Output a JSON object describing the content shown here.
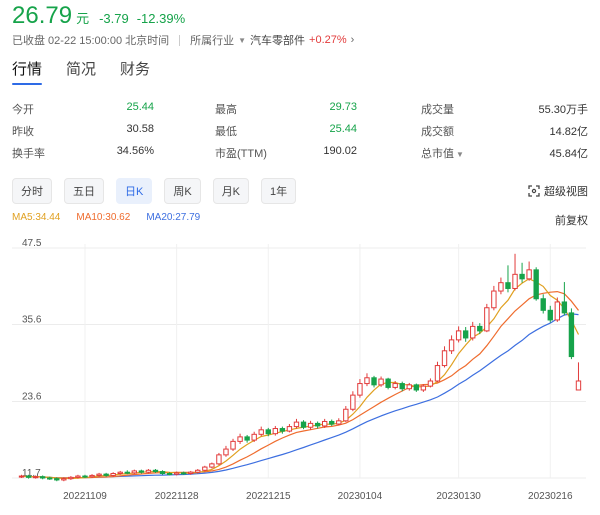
{
  "quote": {
    "price": "26.79",
    "unit": "元",
    "change": "-3.79",
    "change_pct": "-12.39%",
    "status": "已收盘 02-22 15:00:00 北京时间",
    "industry_label": "所属行业",
    "industry_name": "汽车零部件",
    "industry_change": "+0.27%"
  },
  "main_tabs": [
    {
      "label": "行情",
      "active": true
    },
    {
      "label": "简况",
      "active": false
    },
    {
      "label": "财务",
      "active": false
    }
  ],
  "stats": [
    [
      {
        "label": "今开",
        "value": "25.44",
        "tone": "down"
      },
      {
        "label": "最高",
        "value": "29.73",
        "tone": "down"
      },
      {
        "label": "成交量",
        "value": "55.30万手",
        "tone": ""
      }
    ],
    [
      {
        "label": "昨收",
        "value": "30.58",
        "tone": ""
      },
      {
        "label": "最低",
        "value": "25.44",
        "tone": "down"
      },
      {
        "label": "成交额",
        "value": "14.82亿",
        "tone": ""
      }
    ],
    [
      {
        "label": "换手率",
        "value": "34.56%",
        "tone": ""
      },
      {
        "label": "市盈(TTM)",
        "value": "190.02",
        "tone": ""
      },
      {
        "label": "总市值",
        "value": "45.84亿",
        "tone": "",
        "caret": true
      }
    ]
  ],
  "periods": [
    {
      "label": "分时",
      "active": false
    },
    {
      "label": "五日",
      "active": false
    },
    {
      "label": "日K",
      "active": true
    },
    {
      "label": "周K",
      "active": false
    },
    {
      "label": "月K",
      "active": false
    },
    {
      "label": "1年",
      "active": false
    }
  ],
  "super_view_label": "超级视图",
  "ma": {
    "ma5": "MA5:34.44",
    "ma10": "MA10:30.62",
    "ma20": "MA20:27.79"
  },
  "adjust_label": "前复权",
  "chart_data": {
    "type": "candlestick",
    "y_ticks": [
      "47.5",
      "35.6",
      "23.6",
      "11.7"
    ],
    "ylim": [
      11.7,
      47.5
    ],
    "x_ticks": [
      "20221109",
      "20221128",
      "20221215",
      "20230104",
      "20230130",
      "20230216"
    ],
    "x_tick_index": [
      9,
      22,
      35,
      48,
      62,
      75
    ],
    "colors": {
      "up": "#e23b3b",
      "down": "#16a34a",
      "ma5": "#e0a020",
      "ma10": "#ef6c2e",
      "ma20": "#3d6fe0"
    },
    "candles": [
      [
        11.9,
        12.0,
        12.2,
        11.7
      ],
      [
        12.0,
        11.8,
        12.2,
        11.6
      ],
      [
        11.8,
        11.9,
        12.1,
        11.6
      ],
      [
        11.9,
        11.7,
        12.1,
        11.5
      ],
      [
        11.7,
        11.6,
        11.9,
        11.4
      ],
      [
        11.6,
        11.4,
        11.8,
        11.2
      ],
      [
        11.4,
        11.6,
        11.8,
        11.2
      ],
      [
        11.6,
        11.8,
        12.0,
        11.4
      ],
      [
        11.8,
        12.0,
        12.2,
        11.6
      ],
      [
        12.0,
        11.9,
        12.2,
        11.7
      ],
      [
        11.9,
        12.1,
        12.3,
        11.7
      ],
      [
        12.1,
        12.3,
        12.5,
        11.9
      ],
      [
        12.3,
        12.1,
        12.5,
        11.9
      ],
      [
        12.1,
        12.4,
        12.6,
        11.9
      ],
      [
        12.4,
        12.6,
        12.8,
        12.2
      ],
      [
        12.6,
        12.5,
        12.9,
        12.3
      ],
      [
        12.5,
        12.8,
        13.0,
        12.3
      ],
      [
        12.8,
        12.6,
        13.0,
        12.4
      ],
      [
        12.6,
        12.9,
        13.1,
        12.4
      ],
      [
        12.9,
        12.7,
        13.1,
        12.5
      ],
      [
        12.7,
        12.4,
        12.9,
        12.2
      ],
      [
        12.4,
        12.3,
        12.6,
        12.1
      ],
      [
        12.3,
        12.5,
        12.7,
        12.1
      ],
      [
        12.5,
        12.4,
        12.7,
        12.2
      ],
      [
        12.4,
        12.6,
        12.8,
        12.2
      ],
      [
        12.6,
        12.9,
        13.1,
        12.4
      ],
      [
        12.9,
        13.4,
        13.6,
        12.7
      ],
      [
        13.4,
        13.9,
        14.1,
        13.2
      ],
      [
        13.9,
        15.3,
        15.6,
        13.7
      ],
      [
        15.3,
        16.2,
        16.7,
        15.0
      ],
      [
        16.2,
        17.4,
        17.8,
        15.9
      ],
      [
        17.4,
        18.1,
        18.6,
        17.0
      ],
      [
        18.1,
        17.6,
        18.4,
        17.2
      ],
      [
        17.6,
        18.5,
        18.9,
        17.3
      ],
      [
        18.5,
        19.2,
        19.7,
        18.2
      ],
      [
        19.2,
        18.6,
        19.5,
        18.2
      ],
      [
        18.6,
        19.4,
        19.8,
        18.3
      ],
      [
        19.4,
        19.0,
        19.7,
        18.6
      ],
      [
        19.0,
        19.7,
        20.1,
        18.8
      ],
      [
        19.7,
        20.4,
        20.9,
        19.4
      ],
      [
        20.4,
        19.6,
        20.7,
        19.3
      ],
      [
        19.6,
        20.2,
        20.6,
        19.2
      ],
      [
        20.2,
        19.8,
        20.5,
        19.4
      ],
      [
        19.8,
        20.5,
        20.9,
        19.5
      ],
      [
        20.5,
        20.1,
        20.8,
        19.8
      ],
      [
        20.1,
        20.6,
        21.0,
        19.9
      ],
      [
        20.6,
        22.4,
        22.9,
        20.4
      ],
      [
        22.4,
        24.6,
        25.2,
        22.1
      ],
      [
        24.6,
        26.4,
        27.1,
        24.2
      ],
      [
        26.4,
        27.3,
        28.0,
        26.0
      ],
      [
        27.3,
        26.2,
        27.6,
        25.8
      ],
      [
        26.2,
        27.1,
        27.5,
        25.9
      ],
      [
        27.1,
        25.8,
        27.3,
        25.5
      ],
      [
        25.8,
        26.4,
        26.8,
        25.5
      ],
      [
        26.4,
        25.6,
        26.7,
        25.2
      ],
      [
        25.6,
        26.2,
        26.5,
        25.3
      ],
      [
        26.2,
        25.4,
        26.4,
        25.1
      ],
      [
        25.4,
        26.0,
        26.3,
        25.1
      ],
      [
        26.0,
        26.8,
        27.2,
        25.8
      ],
      [
        26.8,
        29.2,
        29.8,
        26.6
      ],
      [
        29.2,
        31.5,
        32.2,
        28.9
      ],
      [
        31.5,
        33.2,
        33.9,
        31.0
      ],
      [
        33.2,
        34.6,
        35.3,
        32.8
      ],
      [
        34.6,
        33.5,
        35.2,
        32.9
      ],
      [
        33.5,
        35.3,
        36.0,
        33.1
      ],
      [
        35.3,
        34.6,
        35.8,
        34.1
      ],
      [
        34.6,
        38.2,
        38.8,
        34.4
      ],
      [
        38.2,
        40.8,
        41.6,
        37.8
      ],
      [
        40.8,
        42.1,
        42.9,
        40.3
      ],
      [
        42.1,
        41.2,
        44.8,
        40.6
      ],
      [
        41.2,
        43.4,
        46.6,
        40.9
      ],
      [
        43.4,
        42.7,
        45.2,
        42.1
      ],
      [
        42.7,
        44.1,
        45.4,
        42.4
      ],
      [
        44.1,
        39.6,
        44.5,
        39.3
      ],
      [
        39.6,
        37.8,
        40.3,
        37.3
      ],
      [
        37.8,
        36.3,
        38.5,
        35.9
      ],
      [
        36.3,
        39.1,
        39.8,
        36.0
      ],
      [
        39.1,
        37.4,
        42.2,
        37.0
      ],
      [
        37.4,
        30.6,
        38.1,
        30.2
      ],
      [
        25.4,
        26.8,
        29.7,
        25.4
      ]
    ]
  }
}
